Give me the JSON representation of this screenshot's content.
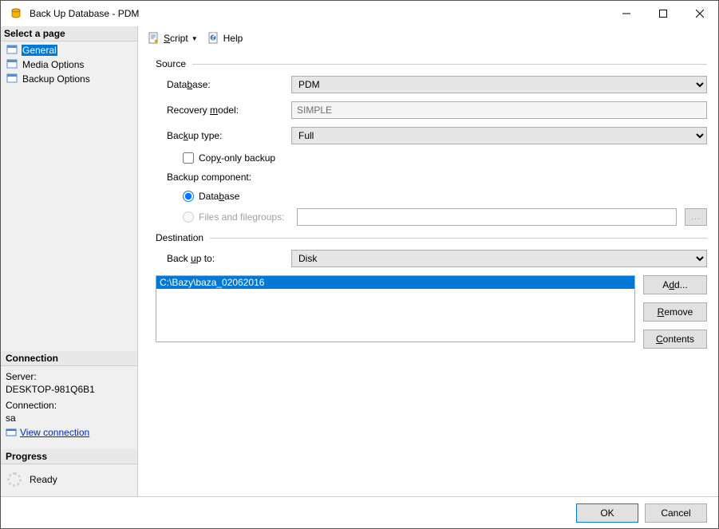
{
  "window": {
    "title": "Back Up Database - PDM"
  },
  "sidebar": {
    "select_page": "Select a page",
    "pages": [
      "General",
      "Media Options",
      "Backup Options"
    ]
  },
  "toolbar": {
    "script": "Script",
    "help": "Help"
  },
  "source": {
    "group": "Source",
    "database_label": "Database:",
    "database_value": "PDM",
    "recovery_label": "Recovery model:",
    "recovery_value": "SIMPLE",
    "backup_type_label": "Backup type:",
    "backup_type_value": "Full",
    "copy_only": "Copy-only backup",
    "component_label": "Backup component:",
    "radio_db": "Database",
    "radio_fg": "Files and filegroups:"
  },
  "destination": {
    "group": "Destination",
    "backup_to_label": "Back up to:",
    "backup_to_value": "Disk",
    "items": [
      "C:\\Bazy\\baza_02062016"
    ],
    "add": "Add...",
    "remove": "Remove",
    "contents": "Contents"
  },
  "connection": {
    "header": "Connection",
    "server_label": "Server:",
    "server_value": "DESKTOP-981Q6B1",
    "conn_label": "Connection:",
    "conn_value": "sa",
    "view_link": "View connection "
  },
  "progress": {
    "header": "Progress",
    "status": "Ready"
  },
  "footer": {
    "ok": "OK",
    "cancel": "Cancel"
  }
}
